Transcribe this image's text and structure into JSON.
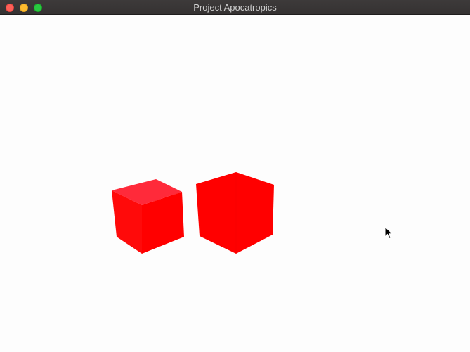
{
  "window": {
    "title": "Project Apocatropics"
  },
  "icons": {
    "close": "close-button",
    "minimize": "minimize-button",
    "zoom": "zoom-button",
    "cursor": "arrow-cursor-icon"
  },
  "colors": {
    "cube_top_left": "#ff2a3a",
    "cube_left": "#ff0909",
    "cube_right_left": "#ff0000",
    "background": "#fdfdfd",
    "titlebar": "#3a3737"
  }
}
